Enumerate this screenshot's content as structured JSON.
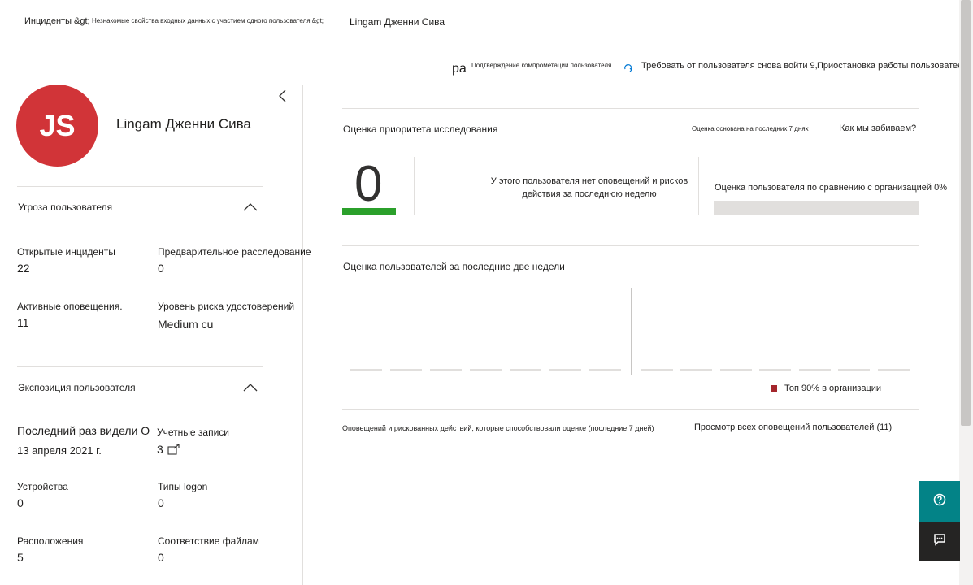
{
  "breadcrumb": {
    "incidents": "Инциденты &gt;",
    "alert": "Незнакомые свойства входных данных с участием одного пользователя &gt;",
    "current": "Lingam Дженни Сива"
  },
  "actions": {
    "prefix": "pa",
    "confirm": "Подтверждение компрометации пользователя",
    "require_signin": "Требовать от пользователя снова войти 9,",
    "suspend": "Приостановка работы пользователя"
  },
  "user": {
    "initials": "JS",
    "name": "Lingam Дженни Сива",
    "avatar_color": "#d13438"
  },
  "threat": {
    "title": "Угроза пользователя",
    "open_incidents_label": "Открытые инциденты",
    "open_incidents_value": "22",
    "preliminary_label": "Предварительное расследование",
    "preliminary_value": "0",
    "active_alerts_label": "Активные оповещения.",
    "active_alerts_value": "11",
    "identity_risk_label": "Уровень риска удостоверений",
    "identity_risk_value": "Medium cu"
  },
  "exposure": {
    "title": "Экспозиция пользователя",
    "last_seen_label": "Последний раз видели О",
    "last_seen_value": "13 апреля 2021 г.",
    "accounts_label": "Учетные записи",
    "accounts_value": "3",
    "devices_label": "Устройства",
    "devices_value": "0",
    "logon_types_label": "Типы logon",
    "logon_types_value": "0",
    "locations_label": "Расположения",
    "locations_value": "5",
    "file_matches_label": "Соответствие файлам",
    "file_matches_value": "0"
  },
  "priority": {
    "title": "Оценка приоритета исследования",
    "basis_note": "Оценка основана на последних 7 днях",
    "how_link": "Как мы забиваем?",
    "score": "0",
    "score_color": "#2ba02b",
    "no_alerts_msg": "У этого пользователя нет оповещений и рисков действия за последнюю неделю",
    "org_compare": "Оценка пользователя по сравнению с организацией 0%",
    "org_compare_fraction": 0
  },
  "two_weeks": {
    "title": "Оценка пользователей за последние две недели",
    "legend": "Топ 90% в организации",
    "legend_color": "#a4262c"
  },
  "footer": {
    "contrib": "Оповещений и рискованных действий, которые способствовали оценке (последние 7 дней)",
    "view_all": "Просмотр всех оповещений пользователей (11)"
  },
  "icons": {
    "collapse": "chevron-left-icon",
    "section_toggle": "chevron-up-icon",
    "external": "external-link-icon",
    "signin": "refresh-user-icon",
    "help": "help-icon",
    "feedback": "feedback-icon"
  }
}
